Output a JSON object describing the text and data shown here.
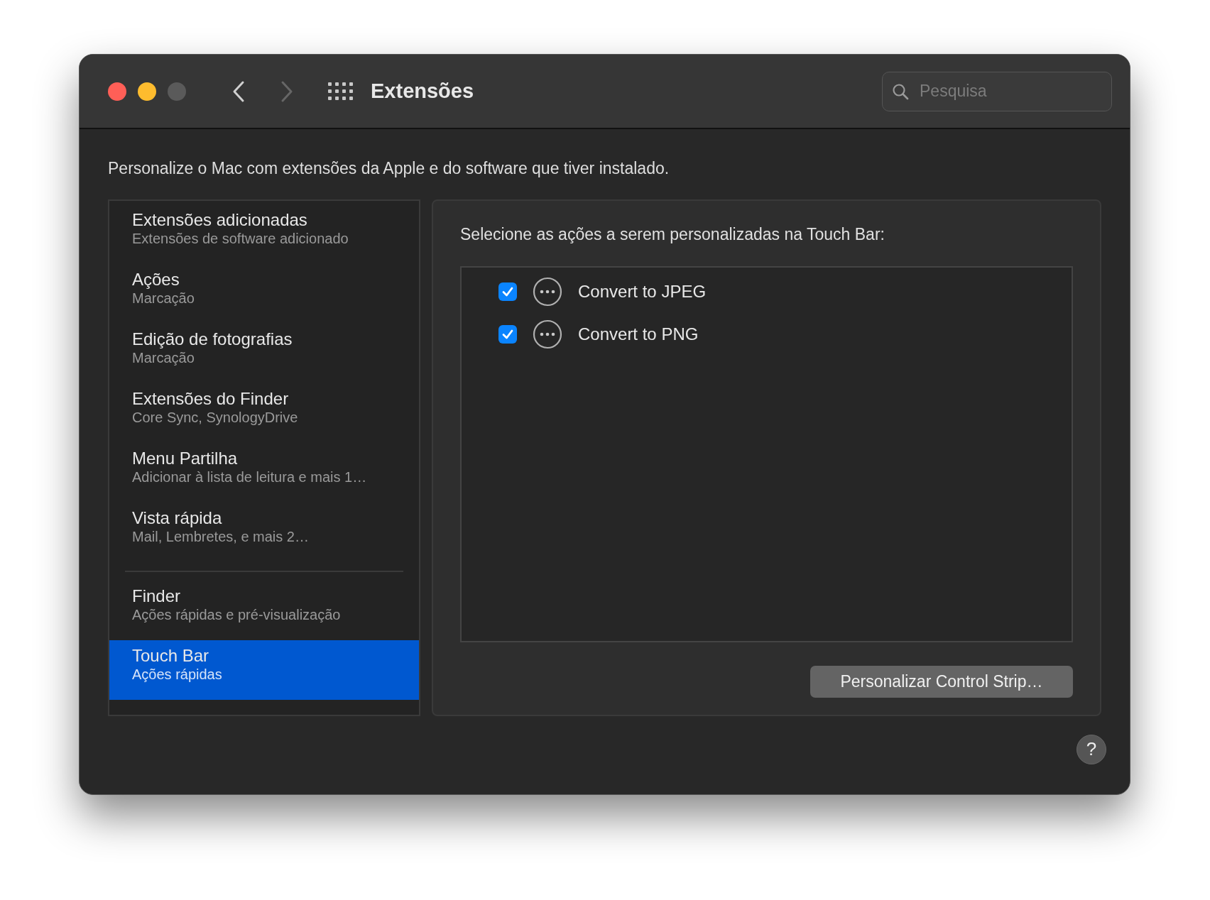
{
  "window": {
    "title": "Extensões"
  },
  "nav": {
    "back_enabled": true,
    "forward_enabled": false
  },
  "search": {
    "placeholder": "Pesquisa"
  },
  "description": "Personalize o Mac com extensões da Apple e do software que tiver instalado.",
  "sidebar": {
    "groups": [
      {
        "items": [
          {
            "title": "Extensões adicionadas",
            "subtitle": "Extensões de software adicionado",
            "selected": false
          },
          {
            "title": "Ações",
            "subtitle": "Marcação",
            "selected": false
          },
          {
            "title": "Edição de fotografias",
            "subtitle": "Marcação",
            "selected": false
          },
          {
            "title": "Extensões do Finder",
            "subtitle": "Core Sync, SynologyDrive",
            "selected": false
          },
          {
            "title": "Menu Partilha",
            "subtitle": "Adicionar à lista de leitura e mais 1…",
            "selected": false
          },
          {
            "title": "Vista rápida",
            "subtitle": "Mail, Lembretes, e mais 2…",
            "selected": false
          }
        ]
      },
      {
        "items": [
          {
            "title": "Finder",
            "subtitle": "Ações rápidas e pré-visualização",
            "selected": false
          },
          {
            "title": "Touch Bar",
            "subtitle": "Ações rápidas",
            "selected": true
          }
        ]
      }
    ]
  },
  "panel": {
    "heading": "Selecione as ações a serem personalizadas na Touch Bar:",
    "actions": [
      {
        "label": "Convert to JPEG",
        "checked": true
      },
      {
        "label": "Convert to PNG",
        "checked": true
      }
    ],
    "button": "Personalizar Control Strip…"
  },
  "help": "?"
}
